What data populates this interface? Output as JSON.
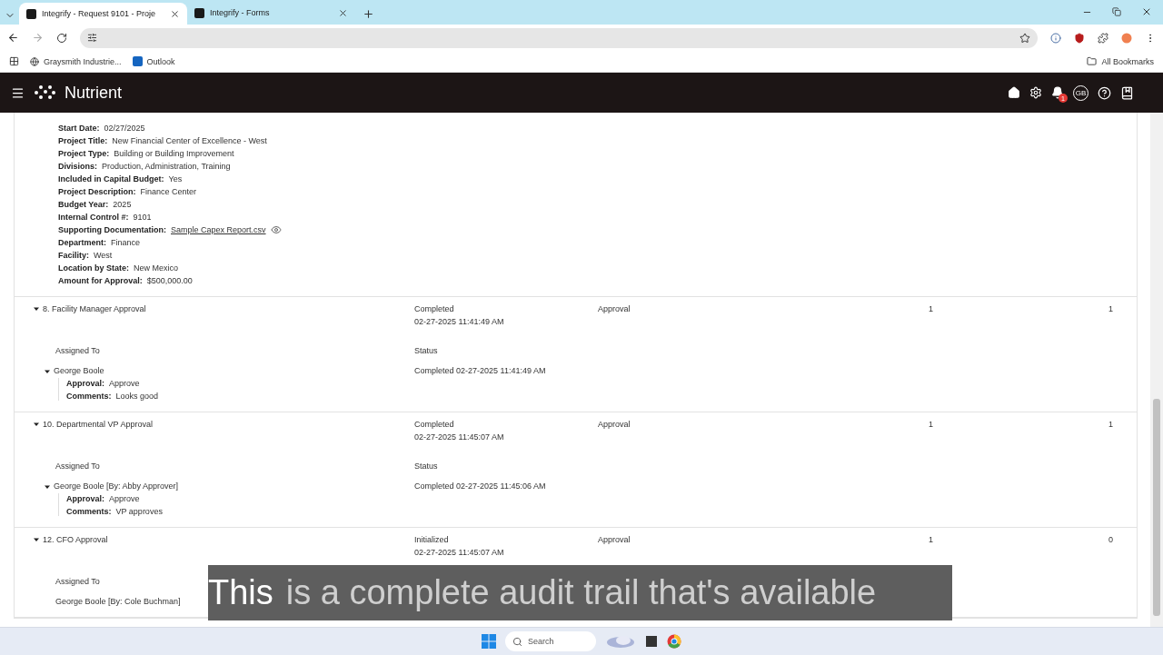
{
  "browser": {
    "tabs": [
      {
        "title": "Integrify - Request 9101 - Proje",
        "selected": true
      },
      {
        "title": "Integrify - Forms",
        "selected": false
      }
    ],
    "bookmarks": [
      "Graysmith Industrie...",
      "Outlook"
    ],
    "all_bookmarks": "All Bookmarks"
  },
  "app_header": {
    "brand": "Nutrient",
    "notification_count": "1",
    "avatar": "GB"
  },
  "details": [
    {
      "label": "Start Date:",
      "value": "02/27/2025",
      "kind": "text"
    },
    {
      "label": "Project Title:",
      "value": "New Financial Center of Excellence - West",
      "kind": "text"
    },
    {
      "label": "Project Type:",
      "value": "Building or Building Improvement",
      "kind": "text"
    },
    {
      "label": "Divisions:",
      "value": "Production, Administration, Training",
      "kind": "text"
    },
    {
      "label": "Included in Capital Budget:",
      "value": "Yes",
      "kind": "text"
    },
    {
      "label": "Project Description:",
      "value": "Finance Center",
      "kind": "text"
    },
    {
      "label": "Budget Year:",
      "value": "2025",
      "kind": "text"
    },
    {
      "label": "Internal Control #:",
      "value": "9101",
      "kind": "text"
    },
    {
      "label": "Supporting Documentation:",
      "value": "Sample Capex Report.csv",
      "kind": "link"
    },
    {
      "label": "Department:",
      "value": "Finance",
      "kind": "text"
    },
    {
      "label": "Facility:",
      "value": "West",
      "kind": "text"
    },
    {
      "label": "Location by State:",
      "value": "New Mexico",
      "kind": "text"
    },
    {
      "label": "Amount for Approval:",
      "value": "$500,000.00",
      "kind": "text"
    }
  ],
  "steps": [
    {
      "title": "8. Facility Manager Approval",
      "expanded": true,
      "status": "Completed",
      "date": "02-27-2025 11:41:49 AM",
      "type": "Approval",
      "column_4": "1",
      "column_5": "1",
      "assigned_label": "Assigned To",
      "status_label": "Status",
      "assignees": [
        {
          "name": "George Boole",
          "expanded": true,
          "status": "Completed 02-27-2025 11:41:49 AM",
          "fields": [
            {
              "label": "Approval:",
              "value": "Approve"
            },
            {
              "label": "Comments:",
              "value": "Looks good"
            }
          ]
        }
      ]
    },
    {
      "title": "10. Departmental VP Approval",
      "expanded": true,
      "status": "Completed",
      "date": "02-27-2025 11:45:07 AM",
      "type": "Approval",
      "column_4": "1",
      "column_5": "1",
      "assigned_label": "Assigned To",
      "status_label": "Status",
      "assignees": [
        {
          "name": "George Boole [By: Abby Approver]",
          "expanded": true,
          "status": "Completed 02-27-2025 11:45:06 AM",
          "fields": [
            {
              "label": "Approval:",
              "value": "Approve"
            },
            {
              "label": "Comments:",
              "value": "VP approves"
            }
          ]
        }
      ]
    },
    {
      "title": "12. CFO Approval",
      "expanded": true,
      "status": "Initialized",
      "date": "02-27-2025 11:45:07 AM",
      "type": "Approval",
      "column_4": "1",
      "column_5": "0",
      "assigned_label": "Assigned To",
      "assignees": [
        {
          "name": "George Boole [By: Cole Buchman]",
          "expanded": false
        }
      ]
    }
  ],
  "caption": {
    "spoken": "This",
    "rest": "is a complete audit trail that's available"
  },
  "taskbar": {
    "search_placeholder": "Search"
  }
}
